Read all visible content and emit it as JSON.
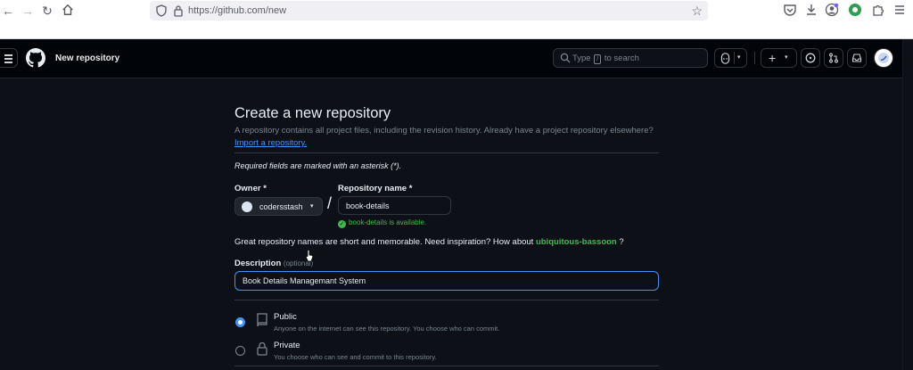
{
  "browser": {
    "url": "https://github.com/new"
  },
  "header": {
    "context_title": "New repository",
    "search_prefix": "Type",
    "search_key": "/",
    "search_suffix": "to search"
  },
  "form": {
    "title": "Create a new repository",
    "subtitle": "A repository contains all project files, including the revision history. Already have a project repository elsewhere?",
    "import_link": "Import a repository.",
    "required_note": "Required fields are marked with an asterisk (*).",
    "owner_label": "Owner *",
    "owner_value": "codersstash",
    "slash": "/",
    "repo_label": "Repository name *",
    "repo_value": "book-details",
    "availability": "book-details is available.",
    "hint_prefix": "Great repository names are short and memorable. Need inspiration? How about",
    "hint_suggestion": "ubiquitous-bassoon",
    "hint_suffix": "?",
    "description_label": "Description",
    "description_optional": "(optional)",
    "description_value": "Book Details Managemant System",
    "visibility": [
      {
        "title": "Public",
        "desc": "Anyone on the internet can see this repository. You choose who can commit.",
        "selected": true
      },
      {
        "title": "Private",
        "desc": "You choose who can see and commit to this repository.",
        "selected": false
      }
    ]
  },
  "colors": {
    "page_bg": "#0d1117",
    "header_bg": "#010409",
    "accent_blue": "#4493f8",
    "success_green": "#3fb950"
  }
}
